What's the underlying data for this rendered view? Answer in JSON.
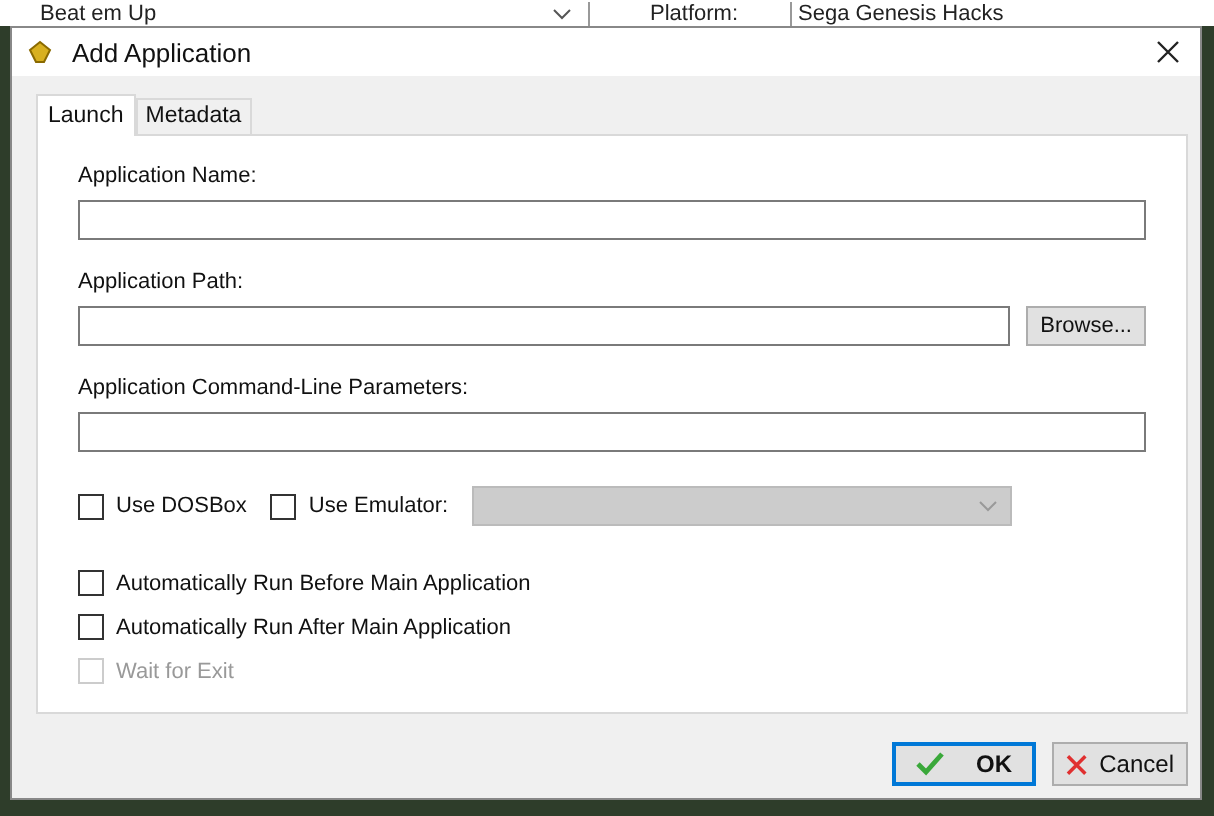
{
  "background_window": {
    "genre_value": "Beat em Up",
    "platform_label": "Platform:",
    "platform_value": "Sega Genesis Hacks"
  },
  "window": {
    "title": "Add Application"
  },
  "tabs": [
    {
      "label": "Launch",
      "selected": true
    },
    {
      "label": "Metadata",
      "selected": false
    }
  ],
  "fields": [
    {
      "label": "Application Name:"
    },
    {
      "label": "Application Path:",
      "button": "Browse..."
    },
    {
      "label": "Application Command-Line Parameters:"
    }
  ],
  "emulator_options": [
    {
      "label": "Use DOSBox",
      "checked": false
    },
    {
      "label": "Use Emulator:",
      "checked": false
    }
  ],
  "emulator_dropdown": {
    "disabled": true
  },
  "run_options": [
    {
      "label": "Automatically Run Before Main Application",
      "checked": false,
      "disabled": false
    },
    {
      "label": "Automatically Run After Main Application",
      "checked": false,
      "disabled": false
    },
    {
      "label": "Wait for Exit",
      "checked": false,
      "disabled": true
    }
  ],
  "buttons": [
    {
      "label": "OK",
      "kind": "ok",
      "default": true
    },
    {
      "label": "Cancel",
      "kind": "cancel",
      "default": false
    }
  ]
}
